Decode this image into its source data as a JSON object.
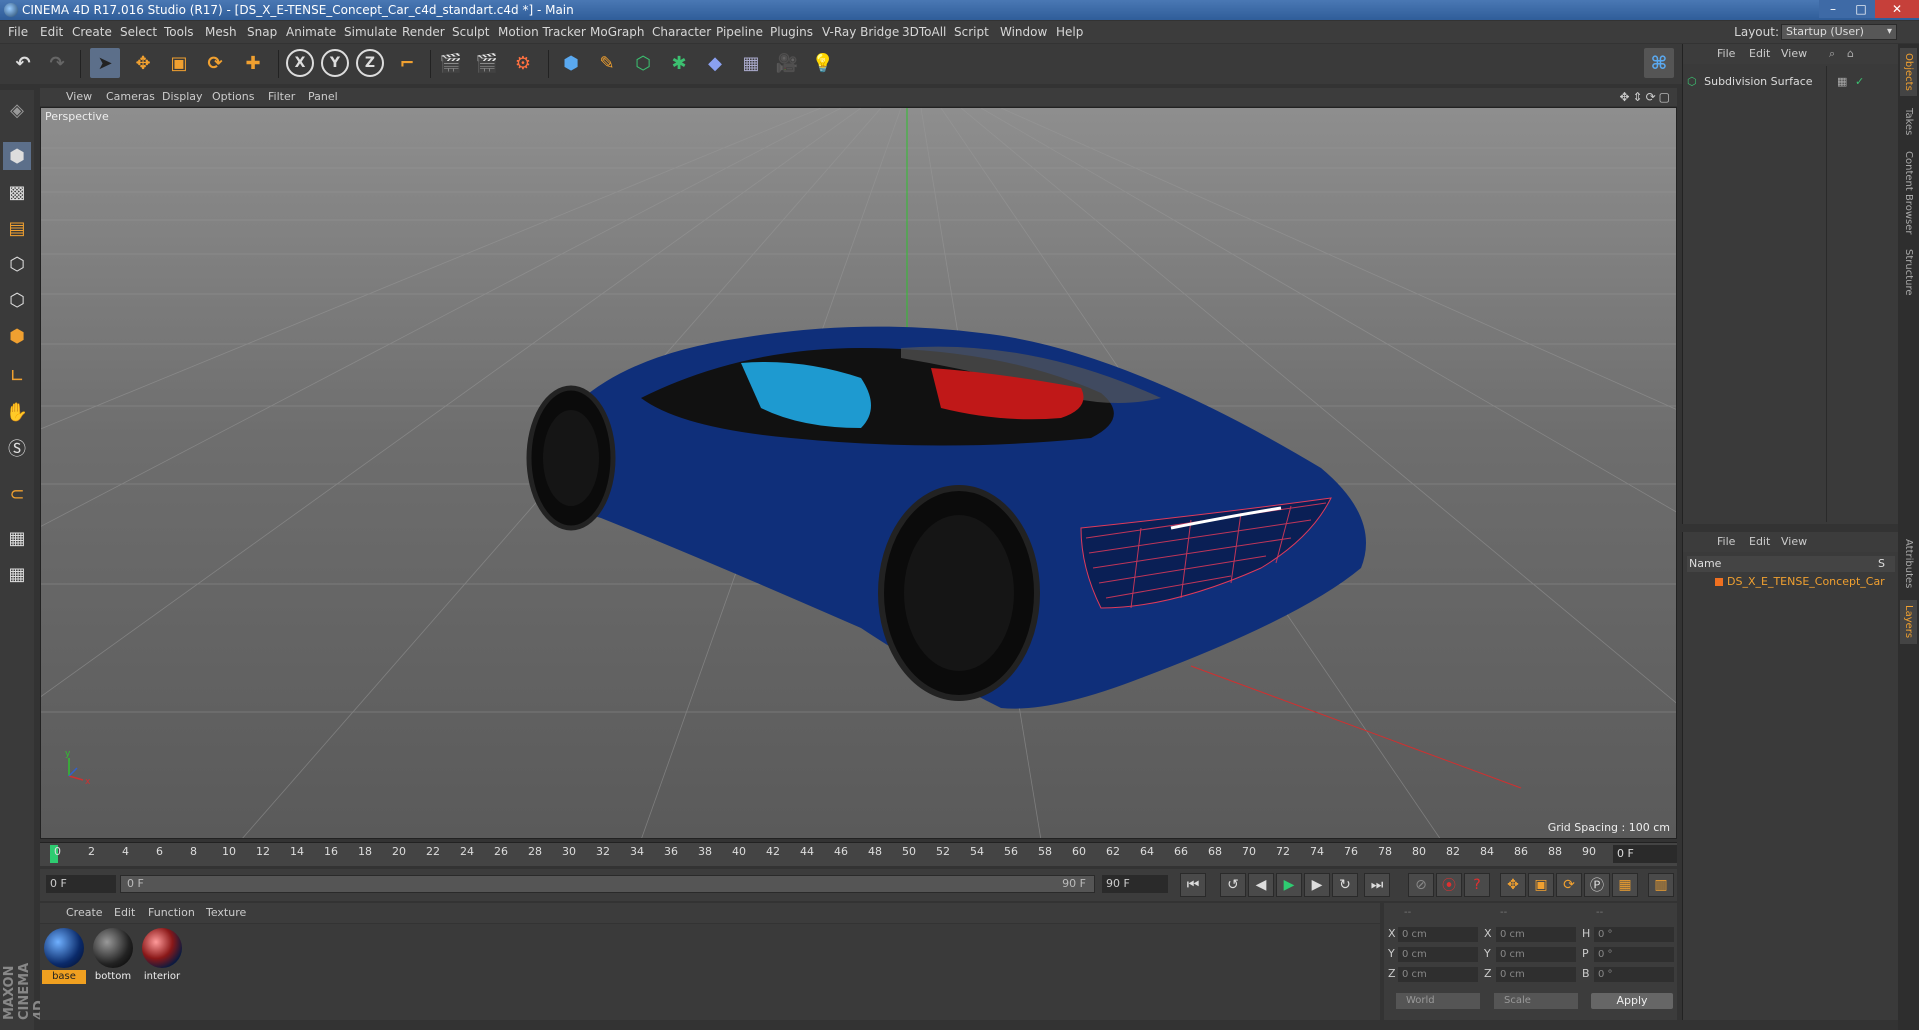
{
  "window": {
    "title": "CINEMA 4D R17.016 Studio (R17) - [DS_X_E-TENSE_Concept_Car_c4d_standart.c4d *] - Main",
    "minimize": "–",
    "maximize": "□",
    "close": "✕"
  },
  "menu": {
    "items": [
      "File",
      "Edit",
      "Create",
      "Select",
      "Tools",
      "Mesh",
      "Snap",
      "Animate",
      "Simulate",
      "Render",
      "Sculpt",
      "Motion Tracker",
      "MoGraph",
      "Character",
      "Pipeline",
      "Plugins",
      "V-Ray Bridge",
      "3DToAll",
      "Script",
      "Window",
      "Help"
    ],
    "layout_label": "Layout:",
    "layout_value": "Startup (User)"
  },
  "toolbar": {
    "axis_x": "X",
    "axis_y": "Y",
    "axis_z": "Z"
  },
  "viewport": {
    "menu": [
      "View",
      "Cameras",
      "Display",
      "Options",
      "Filter",
      "Panel"
    ],
    "label": "Perspective",
    "grid_spacing": "Grid Spacing : 100 cm",
    "axis_y": "y",
    "axis_x": "x",
    "nav_icons": "✥⇕⟳▢"
  },
  "timeline": {
    "ticks": [
      "0",
      "2",
      "4",
      "6",
      "8",
      "10",
      "12",
      "14",
      "16",
      "18",
      "20",
      "22",
      "24",
      "26",
      "28",
      "30",
      "32",
      "34",
      "36",
      "38",
      "40",
      "42",
      "44",
      "46",
      "48",
      "50",
      "52",
      "54",
      "56",
      "58",
      "60",
      "62",
      "64",
      "66",
      "68",
      "70",
      "72",
      "74",
      "76",
      "78",
      "80",
      "82",
      "84",
      "86",
      "88",
      "90"
    ],
    "current_frame": "0 F",
    "start_field": "0 F",
    "slider_start": "0 F",
    "slider_end": "90 F",
    "end_field": "90 F"
  },
  "materials": {
    "menu": [
      "Create",
      "Edit",
      "Function",
      "Texture"
    ],
    "items": [
      {
        "name": "base",
        "selected": true
      },
      {
        "name": "bottom",
        "selected": false
      },
      {
        "name": "interior",
        "selected": false
      }
    ]
  },
  "coordinates": {
    "header": [
      "--",
      "--",
      "--"
    ],
    "rows": [
      {
        "axis": "X",
        "pos": "0 cm",
        "axis2": "X",
        "size": "0 cm",
        "rot_label": "H",
        "rot": "0 °"
      },
      {
        "axis": "Y",
        "pos": "0 cm",
        "axis2": "Y",
        "size": "0 cm",
        "rot_label": "P",
        "rot": "0 °"
      },
      {
        "axis": "Z",
        "pos": "0 cm",
        "axis2": "Z",
        "size": "0 cm",
        "rot_label": "B",
        "rot": "0 °"
      }
    ],
    "mode_select": "World",
    "scale_select": "Scale",
    "apply": "Apply"
  },
  "object_manager": {
    "menu": [
      "File",
      "Edit",
      "View"
    ],
    "objects": [
      {
        "name": "Subdivision Surface"
      }
    ]
  },
  "layer_manager": {
    "menu": [
      "File",
      "Edit",
      "View"
    ],
    "name_header": "Name",
    "s_header": "S",
    "objects": [
      {
        "name": "DS_X_E_TENSE_Concept_Car"
      }
    ]
  },
  "right_tabs": [
    "Objects",
    "Takes",
    "Content Browser",
    "Structure",
    "Attributes",
    "Layers"
  ],
  "branding": "MAXON CINEMA 4D",
  "colors": {
    "accent": "#f0a030",
    "play": "#2ecc71",
    "car_body": "#0f2f7a",
    "axis_red": "#d03030",
    "axis_green": "#30c030"
  }
}
